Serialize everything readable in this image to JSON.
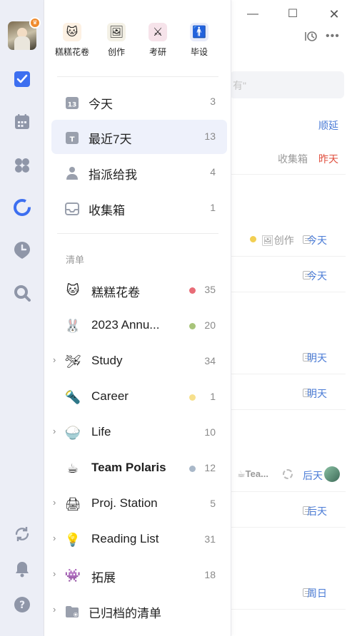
{
  "rail": {
    "icons": [
      "checkbox-icon",
      "calendar-icon",
      "grid-icon",
      "pomodoro-icon",
      "clock-pin-icon",
      "search-icon",
      "sync-icon",
      "bell-icon",
      "help-icon"
    ],
    "accent": "#3d6ff0"
  },
  "drawer": {
    "tiles": [
      {
        "label": "糕糕花卷",
        "emoji": "🐱"
      },
      {
        "label": "创作",
        "emoji": "🖼"
      },
      {
        "label": "考研",
        "emoji": "⚔"
      },
      {
        "label": "毕设",
        "emoji": "🚹"
      }
    ],
    "smart": [
      {
        "label": "今天",
        "count": "3"
      },
      {
        "label": "最近7天",
        "count": "13"
      },
      {
        "label": "指派给我",
        "count": "4"
      },
      {
        "label": "收集箱",
        "count": "1"
      }
    ],
    "section_title": "清单",
    "lists": [
      {
        "label": "糕糕花卷",
        "count": "35",
        "emoji": "🐱",
        "dot": "#e86c77"
      },
      {
        "label": "2023 Annu...",
        "count": "20",
        "emoji": "🐰",
        "dot": "#a8c47a"
      },
      {
        "label": "Study",
        "count": "34",
        "emoji": "🛩"
      },
      {
        "label": "Career",
        "count": "1",
        "emoji": "🔦",
        "dot": "#f7e08c"
      },
      {
        "label": "Life",
        "count": "10",
        "emoji": "🍚"
      },
      {
        "label": "Team Polaris",
        "count": "12",
        "emoji": "☕",
        "dot": "#a9b8c9"
      },
      {
        "label": "Proj. Station",
        "count": "5",
        "emoji": "🖨"
      },
      {
        "label": "Reading List",
        "count": "31",
        "emoji": "💡"
      },
      {
        "label": "拓展",
        "count": "18",
        "emoji": "👾"
      },
      {
        "label": "已归档的清单",
        "count": ""
      }
    ]
  },
  "main": {
    "search_tail": "有\"",
    "postpone": "顺延",
    "inbox_label": "收集箱",
    "yesterday": "昨天",
    "tasks": [
      {
        "tag": "🖼创作",
        "date": "今天"
      },
      {
        "tag": "",
        "date": "今天"
      },
      {
        "tag": "",
        "date": "明天"
      },
      {
        "tag": "",
        "date": "明天"
      },
      {
        "tag": "☕Tea...",
        "date": "后天"
      },
      {
        "tag": "",
        "date": "后天"
      },
      {
        "tag": "",
        "date": "周日"
      }
    ]
  }
}
